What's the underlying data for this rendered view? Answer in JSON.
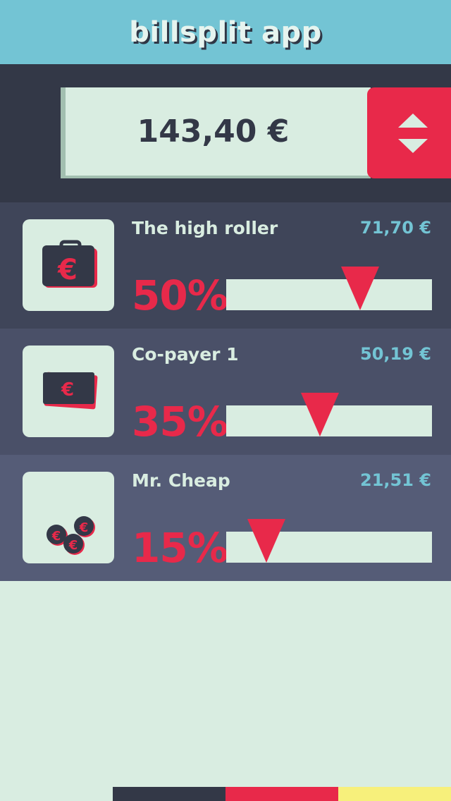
{
  "app": {
    "title": "billsplit app"
  },
  "total": {
    "amount": "143,40 €"
  },
  "icons": {
    "stepper": "up-down-arrows-icon"
  },
  "payers": [
    {
      "name": "The high roller",
      "share": "71,70 €",
      "percent_label": "50%",
      "percent": 50,
      "icon": "briefcase-euro-icon",
      "row_color": "#3f4559"
    },
    {
      "name": "Co-payer 1",
      "share": "50,19 €",
      "percent_label": "35%",
      "percent": 35,
      "icon": "banknote-euro-icon",
      "row_color": "#4a5068"
    },
    {
      "name": "Mr. Cheap",
      "share": "21,51 €",
      "percent_label": "15%",
      "percent": 15,
      "icon": "coins-euro-icon",
      "row_color": "#555c77"
    }
  ],
  "colors": {
    "header": "#73c4d4",
    "dark": "#333847",
    "accent": "#e8294a",
    "light": "#d9ede1",
    "share_text": "#73c4d4",
    "footer": [
      "#333847",
      "#e8294a",
      "#f7f07b"
    ]
  }
}
